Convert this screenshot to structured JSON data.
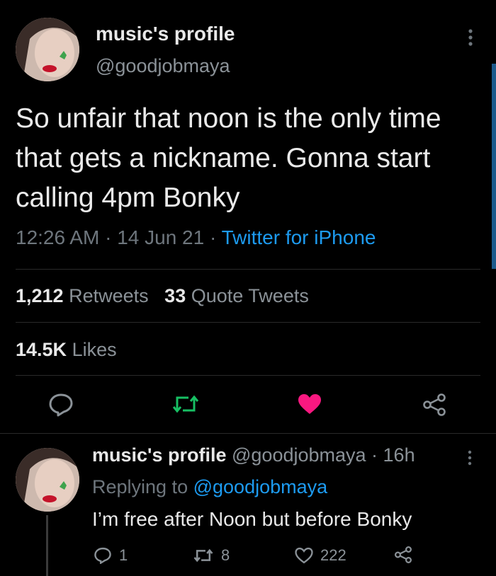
{
  "tweet": {
    "author_name": "music's profile",
    "author_handle": "@goodjobmaya",
    "text": "So unfair that noon is the only time that gets a nickname. Gonna start calling 4pm Bonky",
    "time": "12:26 AM",
    "date": "14 Jun 21",
    "source": "Twitter for iPhone",
    "sep": " · ",
    "retweets_count": "1,212",
    "retweets_label": "Retweets",
    "quotes_count": "33",
    "quotes_label": "Quote Tweets",
    "likes_count": "14.5K",
    "likes_label": "Likes"
  },
  "reply": {
    "author_name": "music's profile",
    "author_handle": "@goodjobmaya",
    "age": "· 16h",
    "replying_label": "Replying to",
    "replying_handle": "@goodjobmaya",
    "text": "I’m free after Noon but before Bonky",
    "reply_count": "1",
    "retweet_count": "8",
    "like_count": "222"
  },
  "colors": {
    "background": "#000000",
    "link": "#1d9bf0",
    "retweet_active": "#17bf63",
    "like_active": "#f91880",
    "muted": "#6e767d"
  },
  "icons": [
    "more-vertical-icon",
    "reply-icon",
    "retweet-icon",
    "heart-icon",
    "share-icon"
  ]
}
